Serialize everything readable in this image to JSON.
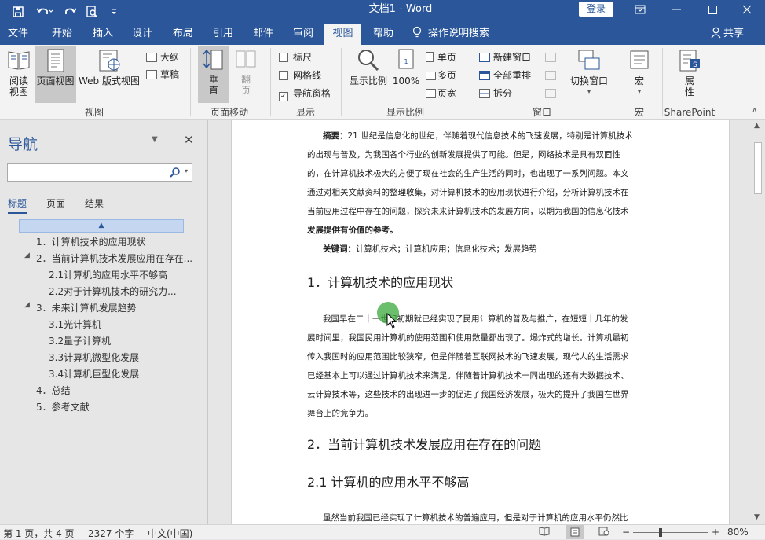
{
  "titlebar": {
    "doc_title": "文档1 - Word",
    "login_label": "登录",
    "qa_save": "save-icon",
    "qa_undo": "undo-icon",
    "qa_redo": "redo-icon",
    "qa_preview": "print-preview-icon",
    "qa_more": "customize-icon"
  },
  "tabs": [
    "文件",
    "开始",
    "插入",
    "设计",
    "布局",
    "引用",
    "邮件",
    "审阅",
    "视图",
    "帮助"
  ],
  "active_tab": "视图",
  "tellme": "操作说明搜索",
  "share": "共享",
  "ribbon": {
    "views": {
      "read": "阅读\n视图",
      "print": "页面视图",
      "web": "Web 版式视图",
      "outline": "大纲",
      "draft": "草稿",
      "group": "视图"
    },
    "pagemove": {
      "vertical": "垂\n直",
      "side": "翻\n页",
      "group": "页面移动"
    },
    "show": {
      "ruler": "标尺",
      "gridlines": "网格线",
      "navpane": "导航窗格",
      "group": "显示"
    },
    "zoom": {
      "zoom": "显示比例",
      "hundred": "100%",
      "one": "单页",
      "multi": "多页",
      "width": "页宽",
      "group": "显示比例"
    },
    "window": {
      "new": "新建窗口",
      "arrange": "全部重排",
      "split": "拆分",
      "switch": "切换窗口",
      "group": "窗口"
    },
    "macro": {
      "label": "宏",
      "group": "宏"
    },
    "sp": {
      "label": "属\n性",
      "group": "SharePoint"
    }
  },
  "nav": {
    "title": "导航",
    "tabs": [
      "标题",
      "页面",
      "结果"
    ],
    "headings": [
      "1．计算机技术的应用现状",
      "2．当前计算机技术发展应用在存在...",
      "2.1计算机的应用水平不够高",
      "2.2对于计算机技术的研究力...",
      "3．未来计算机发展趋势",
      "3.1光计算机",
      "3.2量子计算机",
      "3.3计算机微型化发展",
      "3.4计算机巨型化发展",
      "4．总结",
      "5．参考文献"
    ]
  },
  "doc": {
    "abstract_label": "摘要：",
    "abstract_lines": [
      "21 世纪是信息化的世纪，伴随着现代信息技术的飞速发展，特别是计算机技术",
      "的出现与普及，为我国各个行业的创新发展提供了可能。但是，网络技术是具有双面性",
      "的，在计算机技术极大的方便了现在社会的生产生活的同时，也出现了一系列问题。本文",
      "通过对相关文献资料的整理收集，对计算机技术的应用现状进行介绍，分析计算机技术在",
      "当前应用过程中存在的问题，探究未来计算机技术的发展方向，以期为我国的信息化技术",
      "发展提供有价值的参考。"
    ],
    "keywords_label": "关键词：",
    "keywords": "计算机技术；计算机应用；信息化技术；发展趋势",
    "h1": "1．计算机技术的应用现状",
    "p1_lines": [
      "我国早在二十一世纪初期就已经实现了民用计算机的普及与推广，在短短十几年的发",
      "展时间里，我国民用计算机的使用范围和使用数量都出现了。爆炸式的增长。计算机最初",
      "传入我国时的应用范围比较狭窄，但是伴随着互联网技术的飞速发展，现代人的生活需求",
      "已经基本上可以通过计算机技术来满足。伴随着计算机技术一同出现的还有大数据技术、",
      "云计算技术等，这些技术的出现进一步的促进了我国经济发展，极大的提升了我国在世界",
      "舞台上的竞争力。"
    ],
    "h2": "2．当前计算机技术发展应用在存在的问题",
    "h21": "2.1 计算机的应用水平不够高",
    "p2_line": "虽然当前我国已经实现了计算机技术的普遍应用，但是对于计算机的应用水平仍然比"
  },
  "status": {
    "page": "第 1 页，共 4 页",
    "words": "2327 个字",
    "lang": "中文(中国)",
    "zoom": "80%",
    "zoom_level": 0.8
  },
  "colors": {
    "accent": "#2b579a",
    "cursor_dot": "#3aa83a"
  }
}
